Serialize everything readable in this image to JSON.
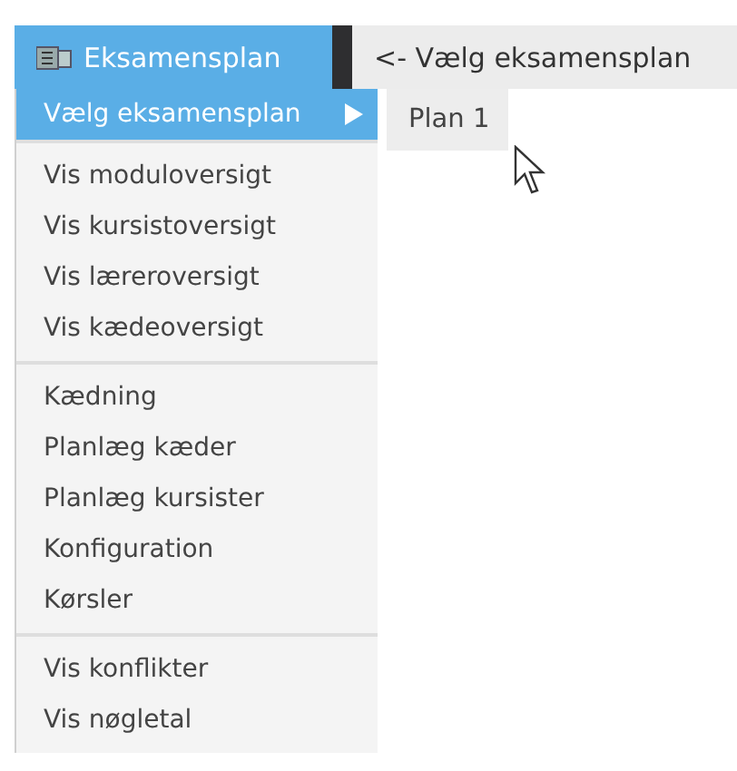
{
  "menu_bar": {
    "tabs": [
      {
        "label": "Eksamensplan",
        "selected": true
      }
    ],
    "breadcrumb": "<- Vælg eksamensplan"
  },
  "menu": {
    "groups": [
      {
        "items": [
          {
            "label": "Vælg eksamensplan",
            "selected": true,
            "has_submenu": true
          }
        ]
      },
      {
        "items": [
          {
            "label": "Vis moduloversigt",
            "selected": false,
            "has_submenu": false
          },
          {
            "label": "Vis kursistoversigt",
            "selected": false,
            "has_submenu": false
          },
          {
            "label": "Vis læreroversigt",
            "selected": false,
            "has_submenu": false
          },
          {
            "label": "Vis kædeoversigt",
            "selected": false,
            "has_submenu": false
          }
        ]
      },
      {
        "items": [
          {
            "label": "Kædning",
            "selected": false,
            "has_submenu": false
          },
          {
            "label": "Planlæg kæder",
            "selected": false,
            "has_submenu": false
          },
          {
            "label": "Planlæg kursister",
            "selected": false,
            "has_submenu": false
          },
          {
            "label": "Konfiguration",
            "selected": false,
            "has_submenu": false
          },
          {
            "label": "Kørsler",
            "selected": false,
            "has_submenu": false
          }
        ]
      },
      {
        "items": [
          {
            "label": "Vis konflikter",
            "selected": false,
            "has_submenu": false
          },
          {
            "label": "Vis nøgletal",
            "selected": false,
            "has_submenu": false
          }
        ]
      }
    ]
  },
  "submenu": {
    "items": [
      {
        "label": "Plan 1",
        "selected": false
      }
    ]
  }
}
